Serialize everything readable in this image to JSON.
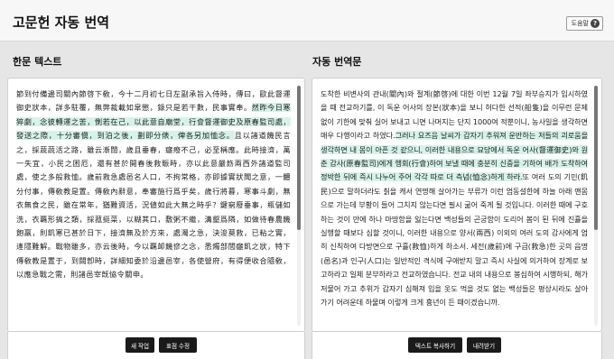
{
  "app": {
    "title": "고문헌 자동 번역",
    "help_label": "도움말",
    "help_icon": "?"
  },
  "source_panel": {
    "title": "한문 텍스트",
    "text_before": "節到付備邊司關內節啓下敎，今十二月初七日左副承旨入侍時，傳曰，歐此督運御史狀本，詳多駐覆，無弊裁載如皐懲，錄只是若干數，民事實奉。",
    "text_highlight": "然昨今日寒猝劇，念彼轉運之苦，惻若在己，以此意自廟堂，行會督運御史及原春監司處，發送之際，十分審愼，到泊之後，劃即分俵，俾各另加恤念。",
    "text_after": "且以諸道饑民言之，採蔬蔬活之路，雖云漸闊，歲且垂春，癰癈不己，必至稱應。此時接濟，萬一失宜，小民之困厄，還有甚於開春後救賑時，亦以此意嚴飭兩西外諸道監司處，使之多般救恤。歲前救急處邑名人口，不拘常格，亦即據實狀聞之意，一體分付事，傳敎教是置。傳敎內辭意，奉審施行爲乎矣，歲行將暮，寒事斗劇，無衣無食之民，雖在常年，猶難資活，況値如此大無之時乎？鍵窮廢垂事，瓶儲如洗，衣覊形搞之類，採菰挺菜，以糊其口，敷粥不繼，溝壑爲隣，如做待春農饑飽羸，則飢寒已甚於日下，接濟無及於方來，處濁之急，決浚莫救，已粘之實，逢隱難解。戰物雖多，亦云後時，今以覊卹饑慘之念，悉燭部閭癰飢之狀，特下傳敎教是置于，到闕卽時，詳細知委於沿邊邑宰，各使營府，有得便收合隨敎，以應急戰之需，則諸邑宰旣恊令關申。"
  },
  "translation_panel": {
    "title": "자동 번역문",
    "text_before": "도착한 비변사의 관내(關內)와 절계(節啓)에 대한 이번 12월 7일 좌부승지가 입시하였을 때 전교하기를, 이 독운 어사의 장본(狀本)을 보니 허다한 선적(船隻)을 이무런 문제없이 기한에 맞춰 실어 보내고 니면 나머지는 단지 1000여 적뿐이니, 농사일을 생각하면 매우 다행이라고 하였다.",
    "text_highlight": "그러나 요즈음 날씨가 갑자기 추워져 운반하는 저들의 괴로움을 생각하면 내 몸이 아픈 것 같으니, 이러한 내용으로 묘당에서 독운 어사(督運御史)와 원춘 감사(原春監司)에게 행회(行會)하여 보낼 때에 충분히 신중을 기하여 배가 도착하여 정박한 뒤에 즉시 나누어 주어 각각 따로 더 측념(恤念)하게 하라.",
    "text_after": "또 여러 도의 기민(飢民)으로 말하더라도 칡을 캐서 연명해 살아가는 부류가 이런 엄동설한에 하늘 아래 맨몸으로 가는데 부황이 들어 그치지 않는다면 필시 굶어 죽게 될 것입니다. 이러한 때에 구호하는 것이 만에 하나 마땅함을 잃는다면 백성들의 곤궁함이 도리어 봄이 된 뒤에 진휼을 실행할 때보다 심할 것이니, 이러한 내용으로 양서(兩西) 이외의 여러 도의 감사에게 엄히 신칙하여 다방면으로 구휼(救恤)하게 하소서. 세전(歲前)에 구급(救急)한 곳의 읍명(邑名)과 인구(人口)는 일반적인 격식에 구애받지 말고 즉시 사실에 의거하여 장계로 보고하라고 일체 분부하라고 전교하였습니다. 전교 내의 내용으로 봉심하여 시행하되, 해가 저물어 가고 추위가 갑자기 심해져 입을 옷도 먹을 것도 없는 백성들은 평상시라도 살아가기 어려운데 하물며 이렇게 크게 흉년이 든 때이겠습니까."
  },
  "buttons": {
    "new_task": "새 작업",
    "edit_text": "표점 수정",
    "copy_text": "텍스트 복사하기",
    "download": "내려받기"
  }
}
